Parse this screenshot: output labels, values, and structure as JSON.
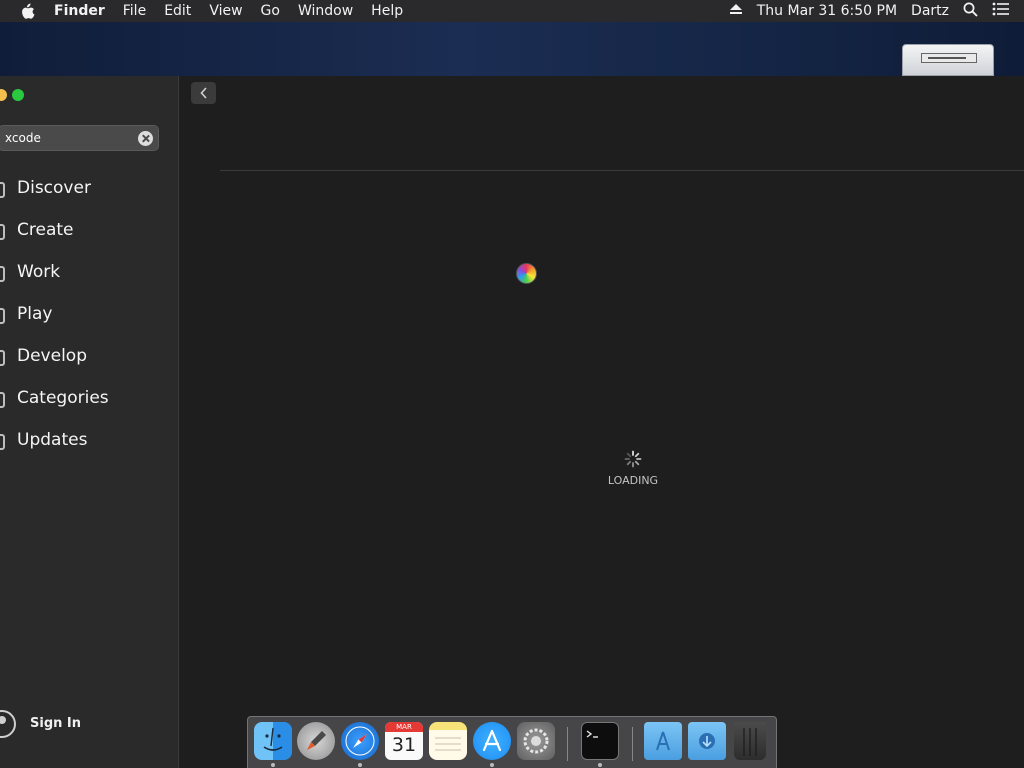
{
  "menubar": {
    "app_name": "Finder",
    "items": [
      "File",
      "Edit",
      "View",
      "Go",
      "Window",
      "Help"
    ],
    "clock": "Thu Mar 31  6:50 PM",
    "user": "Dartz",
    "icons": [
      "apple-icon",
      "eject-icon",
      "spotlight-search-icon",
      "notification-center-icon"
    ]
  },
  "desktop": {
    "icons": [
      "hard-disk-icon"
    ]
  },
  "window": {
    "search": {
      "value": "xcode"
    },
    "nav": [
      {
        "label": "Discover",
        "icon": "star-icon"
      },
      {
        "label": "Create",
        "icon": "brush-icon"
      },
      {
        "label": "Work",
        "icon": "paper-plane-icon"
      },
      {
        "label": "Play",
        "icon": "rocket-icon"
      },
      {
        "label": "Develop",
        "icon": "hammer-icon"
      },
      {
        "label": "Categories",
        "icon": "grid-icon"
      },
      {
        "label": "Updates",
        "icon": "download-icon"
      }
    ],
    "sign_in": "Sign In",
    "content": {
      "loading": "LOADING"
    }
  },
  "dock": {
    "apps": [
      "finder-icon",
      "launchpad-icon",
      "safari-icon",
      "calendar-icon",
      "notes-icon",
      "app-store-icon",
      "system-preferences-icon",
      "terminal-icon",
      "applications-folder-icon",
      "downloads-folder-icon",
      "trash-icon"
    ],
    "calendar": {
      "month": "MAR",
      "day": "31"
    }
  },
  "colors": {
    "traffic_yellow": "#f5bf4f",
    "traffic_green": "#29c940",
    "sidebar_bg": "#2a2a2a",
    "content_bg": "#1e1e1e",
    "app_store_blue": "#1e8df5"
  }
}
